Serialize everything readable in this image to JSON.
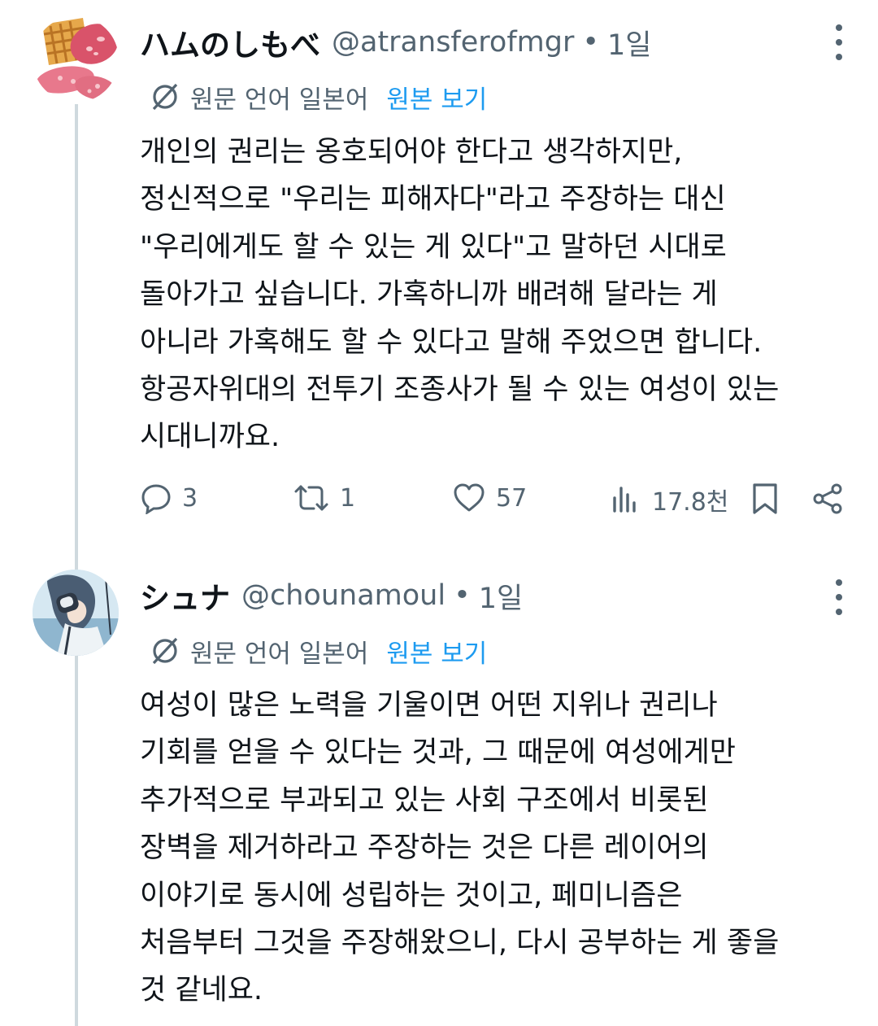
{
  "posts": [
    {
      "display_name": "ハムのしもべ",
      "handle": "@atransferofmgr",
      "separator": "•",
      "time": "1일",
      "translation_note": "원문 언어 일본어",
      "show_original": "원본 보기",
      "lines": [
        "개인의 권리는 옹호되어야 한다고 생각하지만,",
        "정신적으로 \"우리는 피해자다\"라고 주장하는 대신",
        "\"우리에게도 할 수 있는 게 있다\"고 말하던 시대로",
        "돌아가고 싶습니다. 가혹하니까 배려해 달라는 게",
        "아니라 가혹해도 할 수 있다고 말해 주었으면 합니다.",
        "항공자위대의 전투기 조종사가 될 수 있는 여성이 있는",
        "시대니까요."
      ],
      "stats": {
        "replies": "3",
        "reposts": "1",
        "likes": "57",
        "views": "17.8천"
      }
    },
    {
      "display_name": "シュナ",
      "handle": "@chounamoul",
      "separator": "•",
      "time": "1일",
      "translation_note": "원문 언어 일본어",
      "show_original": "원본 보기",
      "lines": [
        "여성이 많은 노력을 기울이면 어떤 지위나 권리나",
        "기회를 얻을 수 있다는 것과, 그 때문에 여성에게만",
        "추가적으로 부과되고 있는 사회 구조에서 비롯된",
        "장벽을 제거하라고 주장하는 것은 다른 레이어의",
        "이야기로 동시에 성립하는 것이고, 페미니즘은",
        "처음부터 그것을 주장해왔으니, 다시 공부하는 게 좋을",
        "것 같네요."
      ]
    }
  ],
  "icons": {
    "translate": "translate-icon",
    "reply": "reply-icon",
    "repost": "repost-icon",
    "like": "heart-icon",
    "views": "views-icon",
    "bookmark": "bookmark-icon",
    "share": "share-icon",
    "more": "more-vertical-icon"
  },
  "colors": {
    "text": "#0f1419",
    "secondary": "#536471",
    "accent": "#1d9bf0",
    "thread_line": "#cfd9de"
  }
}
